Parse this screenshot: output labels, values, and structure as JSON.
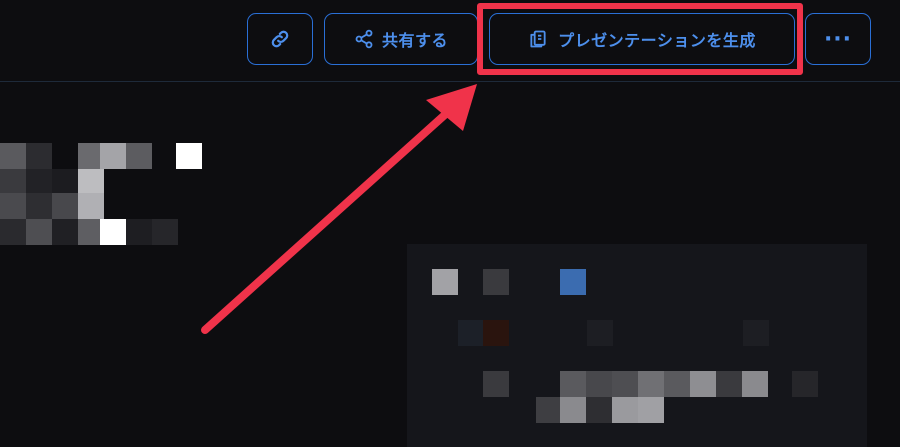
{
  "toolbar": {
    "link_icon": "link-icon",
    "share_icon": "share-icon",
    "share_label": "共有する",
    "generate_icon": "presentation-icon",
    "generate_label": "プレゼンテーションを生成",
    "more_label": "···"
  },
  "annotation": {
    "highlight_color": "#f0334a",
    "arrow_color": "#f0334a"
  },
  "colors": {
    "background": "#0d0d10",
    "accent": "#2a6fd6",
    "accent_text": "#4d8fec"
  }
}
